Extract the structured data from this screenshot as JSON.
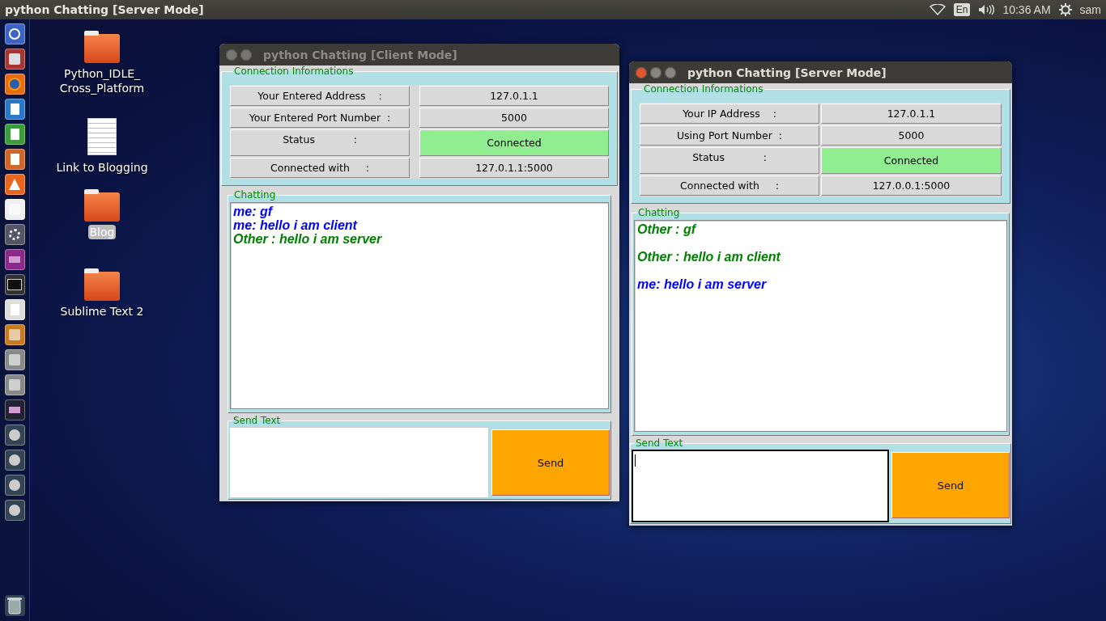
{
  "top_panel": {
    "title": "python Chatting [Server Mode]",
    "keyboard": "En",
    "clock": "10:36 AM",
    "user": "sam"
  },
  "desktop_icons": [
    {
      "label": "Python_IDLE_\nCross_Platform",
      "kind": "folder",
      "selected": false
    },
    {
      "label": "Link to Blogging",
      "kind": "document",
      "selected": false
    },
    {
      "label": "Blog",
      "kind": "folder",
      "selected": true
    },
    {
      "label": "Sublime Text 2",
      "kind": "folder",
      "selected": false
    }
  ],
  "windows": [
    {
      "title": "python Chatting [Client Mode]",
      "active": false,
      "kind": "client",
      "connection": {
        "legend": "Connection Informations",
        "rows": [
          {
            "label": "Your Entered Address    :",
            "value": "127.0.1.1",
            "highlight": false
          },
          {
            "label": "Your Entered Port Number  :",
            "value": "5000",
            "highlight": false
          },
          {
            "label": "Status            :",
            "value": "Connected",
            "highlight": true
          },
          {
            "label": "Connected with     :",
            "value": "127.0.1.1:5000",
            "highlight": false
          }
        ]
      },
      "chat": {
        "legend": "Chatting",
        "kind": "compact",
        "messages": [
          {
            "kind": "me",
            "text": "me: gf"
          },
          {
            "kind": "me",
            "text": "me: hello i am client"
          },
          {
            "kind": "other",
            "text": "Other : hello i am server"
          }
        ]
      },
      "send": {
        "legend": "Send Text",
        "button": "Send",
        "focused": false
      }
    },
    {
      "title": "python Chatting [Server Mode]",
      "active": true,
      "kind": "server",
      "connection": {
        "legend": "Connection Informations",
        "rows": [
          {
            "label": "Your IP Address    :",
            "value": "127.0.1.1",
            "highlight": false
          },
          {
            "label": "Using Port Number  :",
            "value": "5000",
            "highlight": false
          },
          {
            "label": "Status            :",
            "value": "Connected",
            "highlight": true
          },
          {
            "label": "Connected with     :",
            "value": "127.0.0.1:5000",
            "highlight": false
          }
        ]
      },
      "chat": {
        "legend": "Chatting",
        "kind": "spaced",
        "messages": [
          {
            "kind": "other",
            "text": "Other : gf"
          },
          {
            "kind": "other",
            "text": "Other : hello i am client"
          },
          {
            "kind": "me",
            "text": "me: hello i am server"
          }
        ]
      },
      "send": {
        "legend": "Send Text",
        "button": "Send",
        "focused": true
      }
    }
  ]
}
